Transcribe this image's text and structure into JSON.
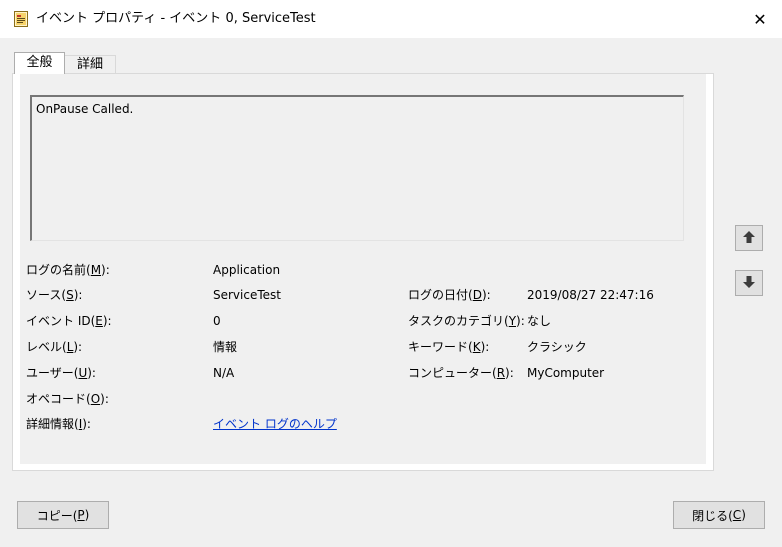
{
  "window": {
    "title": "イベント プロパティ - イベント 0, ServiceTest",
    "close_glyph": "✕"
  },
  "tabs": [
    {
      "label": "全般",
      "selected": true
    },
    {
      "label": "詳細",
      "selected": false
    }
  ],
  "message": "OnPause Called.",
  "fields": {
    "log_name": {
      "label_pre": "ログの名前(",
      "key": "M",
      "label_post": "):",
      "value": "Application"
    },
    "source": {
      "label_pre": "ソース(",
      "key": "S",
      "label_post": "):",
      "value": "ServiceTest"
    },
    "event_id": {
      "label_pre": "イベント ID(",
      "key": "E",
      "label_post": "):",
      "value": "0"
    },
    "level": {
      "label_pre": "レベル(",
      "key": "L",
      "label_post": "):",
      "value": "情報"
    },
    "user": {
      "label_pre": "ユーザー(",
      "key": "U",
      "label_post": "):",
      "value": "N/A"
    },
    "opcode": {
      "label_pre": "オペコード(",
      "key": "O",
      "label_post": "):",
      "value": ""
    },
    "more_info": {
      "label_pre": "詳細情報(",
      "key": "I",
      "label_post": "):",
      "value": "イベント ログのヘルプ"
    },
    "logged": {
      "label_pre": "ログの日付(",
      "key": "D",
      "label_post": "):",
      "value": "2019/08/27 22:47:16"
    },
    "task_category": {
      "label_pre": "タスクのカテゴリ(",
      "key": "Y",
      "label_post": "):",
      "value": "なし"
    },
    "keywords": {
      "label_pre": "キーワード(",
      "key": "K",
      "label_post": "):",
      "value": "クラシック"
    },
    "computer": {
      "label_pre": "コンピューター(",
      "key": "R",
      "label_post": "):",
      "value": "MyComputer"
    }
  },
  "buttons": {
    "copy": {
      "pre": "コピー(",
      "key": "P",
      "post": ")"
    },
    "close": {
      "pre": "閉じる(",
      "key": "C",
      "post": ")"
    }
  },
  "icons": {
    "app": "event-viewer-icon",
    "up": "arrow-up-icon",
    "down": "arrow-down-icon"
  }
}
